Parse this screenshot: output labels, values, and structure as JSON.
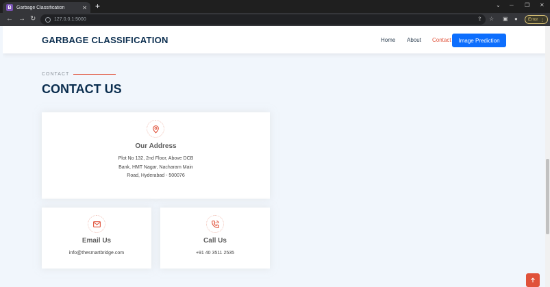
{
  "browser": {
    "tab_favicon": "B",
    "tab_title": "Garbage Classification",
    "tab_close": "✕",
    "new_tab": "+",
    "url": "127.0.0.1:5000",
    "error_label": "Error"
  },
  "header": {
    "logo": "GARBAGE CLASSIFICATION",
    "nav": [
      "Home",
      "About",
      "Contact"
    ],
    "cta": "Image Prediction"
  },
  "section": {
    "subtitle": "CONTACT",
    "title": "CONTACT US"
  },
  "address": {
    "icon": "map-pin-icon",
    "heading": "Our Address",
    "lines": [
      "Plot No 132, 2nd Floor, Above DCB",
      "Bank, HMT Nagar, Nacharam Main",
      "Road, Hyderabad - 500076"
    ]
  },
  "email": {
    "icon": "envelope-icon",
    "heading": "Email Us",
    "value": "info@thesmartbridge.com"
  },
  "call": {
    "icon": "phone-call-icon",
    "heading": "Call Us",
    "value": "+91 40 3511 2535"
  },
  "colors": {
    "accent": "#e0523a",
    "primary_button": "#0d6efd",
    "heading": "#0b2e4f",
    "page_bg": "#f1f6fc"
  }
}
